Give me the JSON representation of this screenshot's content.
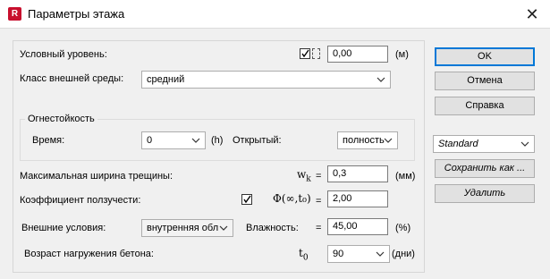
{
  "window": {
    "title": "Параметры этажа",
    "app_icon_text": "R"
  },
  "level": {
    "label": "Условный уровень:",
    "value": "0,00",
    "unit": "(м)"
  },
  "env_class": {
    "label": "Класс внешней среды:",
    "value": "средний"
  },
  "fire": {
    "group_title": "Огнестойкость",
    "time_label": "Время:",
    "time_value": "0",
    "time_unit": "(h)",
    "open_label": "Открытый:",
    "open_value": "полность"
  },
  "crack": {
    "label": "Максимальная ширина трещины:",
    "symbol": "w",
    "subscript": "k",
    "eq": "=",
    "value": "0,3",
    "unit": "(мм)"
  },
  "creep": {
    "label": "Коэффициент ползучести:",
    "symbol": "Φ(∞,t₀)",
    "eq": "=",
    "value": "2,00"
  },
  "ext": {
    "label": "Внешние условия:",
    "value": "внутренняя обл",
    "humidity_label": "Влажность:",
    "eq": "=",
    "humidity_value": "45,00",
    "humidity_unit": "(%)"
  },
  "age": {
    "label": "Возраст нагружения бетона:",
    "symbol": "t",
    "subscript": "0",
    "value": "90",
    "unit": "(дни)"
  },
  "buttons": {
    "ok": "OK",
    "cancel": "Отмена",
    "help": "Справка",
    "save": "Сохранить как ...",
    "delete": "Удалить"
  },
  "style_select": {
    "value": "Standard"
  },
  "colors": {
    "accent": "#0078d7",
    "app_icon": "#c8102e",
    "background": "#f0f0f0"
  }
}
